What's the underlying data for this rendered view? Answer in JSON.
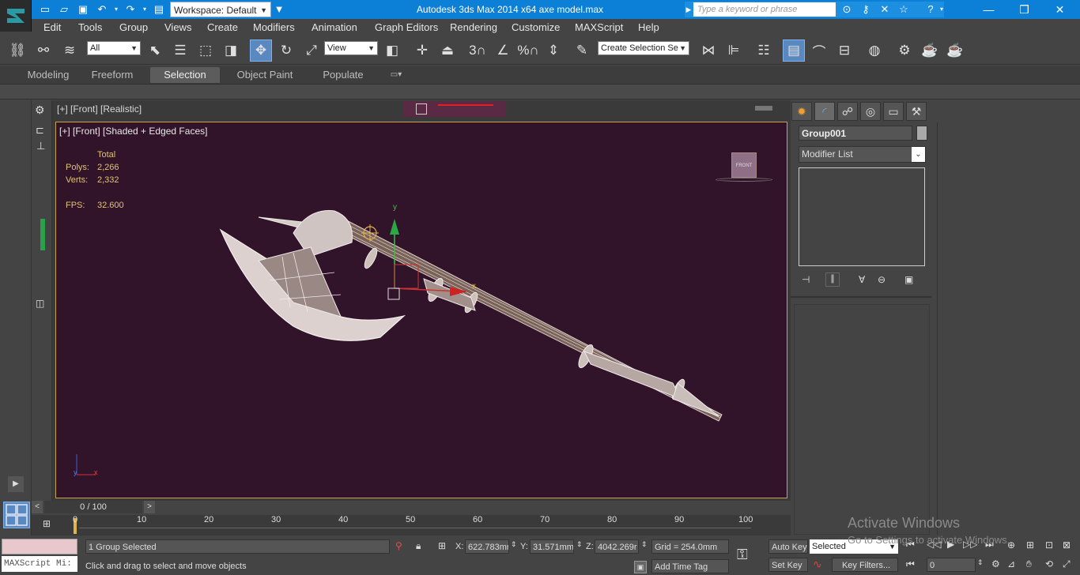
{
  "titlebar": {
    "workspace_label": "Workspace: Default",
    "app_title": "Autodesk 3ds Max  2014 x64      axe model.max",
    "search_placeholder": "Type a keyword or phrase"
  },
  "menu": [
    "Edit",
    "Tools",
    "Group",
    "Views",
    "Create",
    "Modifiers",
    "Animation",
    "Graph Editors",
    "Rendering",
    "Customize",
    "MAXScript",
    "Help"
  ],
  "toolbar": {
    "filter_value": "All",
    "refcoord_value": "View",
    "selection_set_value": "Create Selection Se",
    "snap_3": "3",
    "snap_angle_pct": "%"
  },
  "ribbon": {
    "tabs": [
      "Modeling",
      "Freeform",
      "Selection",
      "Object Paint",
      "Populate"
    ],
    "selected": "Selection"
  },
  "viewport": {
    "top_header": "[+] [Front] [Realistic]",
    "label": "[+] [Front] [Shaded + Edged Faces]",
    "stats": {
      "total_label": "Total",
      "polys_label": "Polys:",
      "polys_value": "2,266",
      "verts_label": "Verts:",
      "verts_value": "2,332",
      "fps_label": "FPS:",
      "fps_value": "32.600"
    },
    "viewcube_label": "FRONT",
    "gizmo": {
      "x": "x",
      "y": "y"
    },
    "axes": {
      "x": "x",
      "y": "y"
    }
  },
  "command_panel": {
    "object_name": "Group001",
    "modifier_list": "Modifier List"
  },
  "timeline": {
    "frame_counter": "0 / 100",
    "ticks": [
      "0",
      "10",
      "20",
      "30",
      "40",
      "50",
      "60",
      "70",
      "80",
      "90",
      "100"
    ]
  },
  "status": {
    "maxscript_label": "MAXScript Mi:",
    "selection_info": "1 Group Selected",
    "prompt": "Click and drag to select and move objects",
    "x_label": "X:",
    "x_value": "622.783mr",
    "y_label": "Y:",
    "y_value": "31.571mm",
    "z_label": "Z:",
    "z_value": "4042.269r",
    "grid": "Grid = 254.0mm",
    "add_time_tag": "Add Time Tag",
    "auto_key": "Auto Key",
    "set_key": "Set Key",
    "selected_value": "Selected",
    "key_filters": "Key Filters...",
    "frame_value": "0"
  },
  "watermark": {
    "line1": "Activate Windows",
    "line2": "Go to Settings to activate Windows."
  },
  "colors": {
    "titlebar": "#0c7fd6",
    "viewport_bg": "#32142a",
    "viewport_border": "#c8a14a",
    "stats_text": "#e2c36b",
    "selected_tool": "#5a88c0"
  }
}
